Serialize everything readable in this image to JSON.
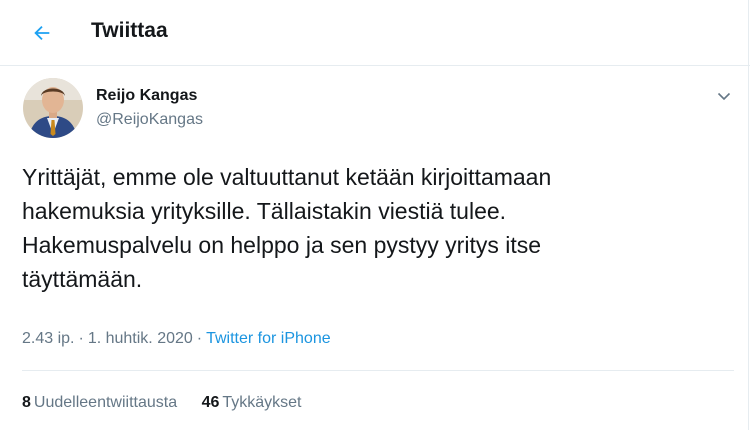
{
  "header": {
    "back_icon": "arrow-left-icon",
    "title": "Twiittaa",
    "accent_color": "#1da1f2"
  },
  "tweet": {
    "author": {
      "name": "Reijo Kangas",
      "handle": "@ReijoKangas",
      "avatar": "profile-photo"
    },
    "menu_icon": "chevron-down-icon",
    "lines": [
      "Yrittäjät, emme ole valtuuttanut ketään kirjoittamaan",
      "hakemuksia yrityksille. Tällaistakin viestiä tulee.",
      "Hakemuspalvelu on helppo ja sen pystyy yritys itse",
      "täyttämään."
    ],
    "time": "2.43 ip.",
    "separator": "·",
    "date": "1. huhtik. 2020",
    "source": "Twitter for iPhone",
    "source_color": "#1b95e0"
  },
  "stats": {
    "retweets_count": "8",
    "retweets_label": "Uudelleentwiittausta",
    "likes_count": "46",
    "likes_label": "Tykkäykset"
  }
}
